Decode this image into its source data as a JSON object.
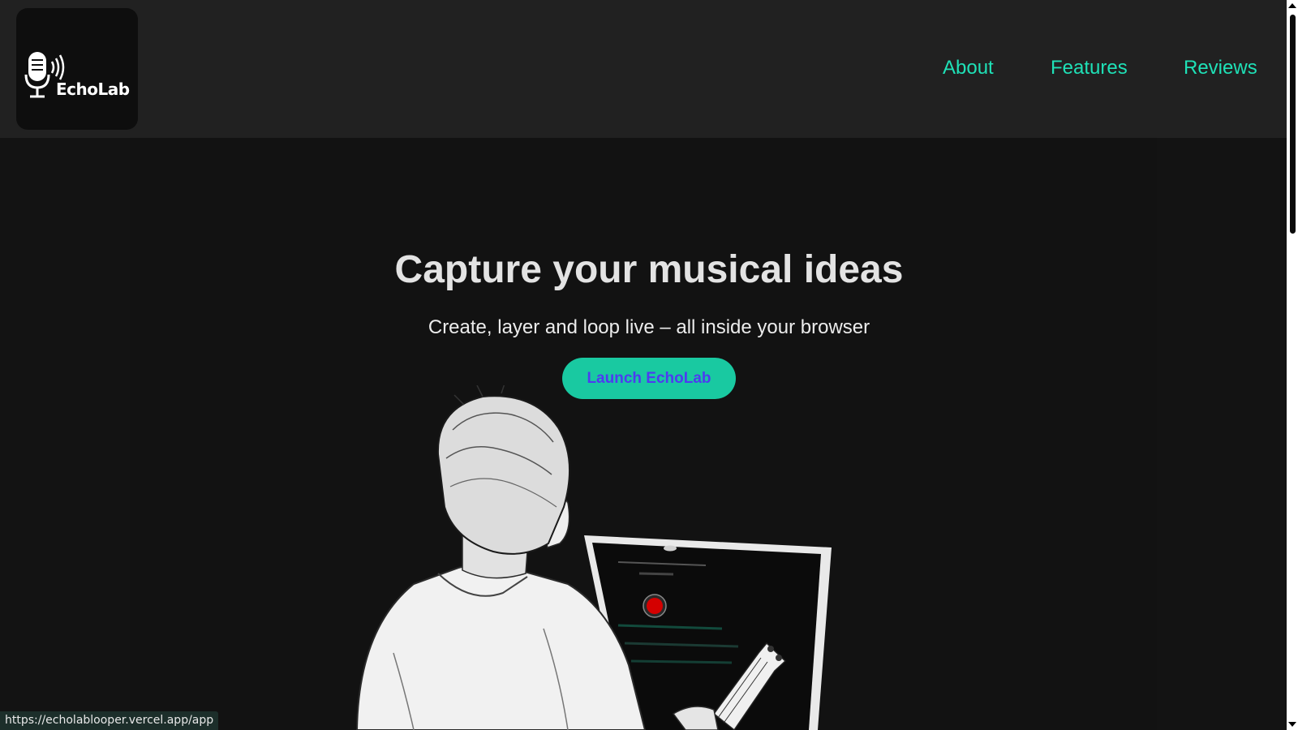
{
  "brand": {
    "name": "EchoLab"
  },
  "nav": {
    "about": "About",
    "features": "Features",
    "reviews": "Reviews"
  },
  "hero": {
    "title": "Capture your musical ideas",
    "subtitle": "Create, layer and loop live – all inside your browser",
    "cta": "Launch EchoLab"
  },
  "status_bar": {
    "url": "https://echolablooper.vercel.app/app"
  },
  "colors": {
    "accent": "#1fe1b7",
    "button_bg": "#19c9a1",
    "button_text": "#4d3cf0",
    "header_bg": "#212121",
    "page_bg": "#131313"
  }
}
